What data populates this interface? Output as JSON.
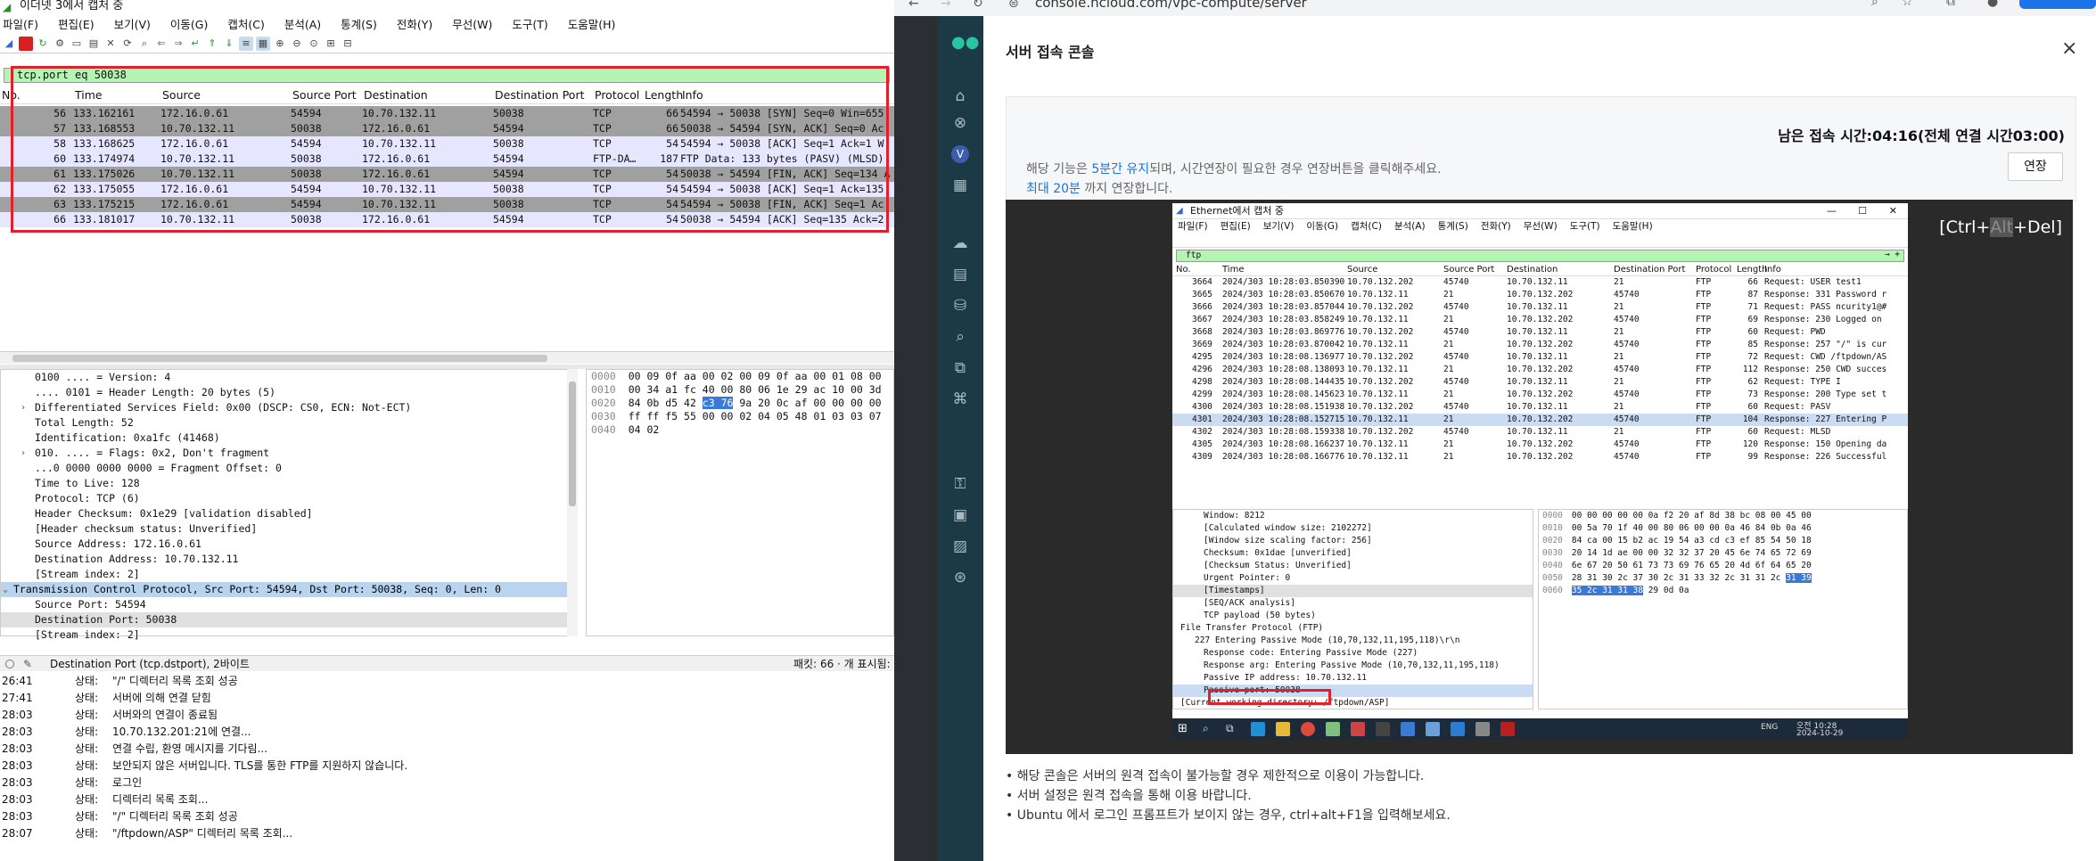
{
  "wireshark": {
    "title": "이더넷 3에서 캡처 중",
    "menu": [
      "파일(F)",
      "편집(E)",
      "보기(V)",
      "이동(G)",
      "캡처(C)",
      "분석(A)",
      "통계(S)",
      "전화(Y)",
      "무선(W)",
      "도구(T)",
      "도움말(H)"
    ],
    "filter": "tcp.port eq 50038",
    "columns": [
      "No.",
      "Time",
      "Source",
      "Source Port",
      "Destination",
      "Destination Port",
      "Protocol",
      "Length",
      "Info"
    ],
    "packets": [
      {
        "no": "56",
        "time": "133.162161",
        "src": "172.16.0.61",
        "sport": "54594",
        "dst": "10.70.132.11",
        "dport": "50038",
        "proto": "TCP",
        "len": "66",
        "info": "54594 → 50038 [SYN] Seq=0 Win=655",
        "bg": "#a0a0a0"
      },
      {
        "no": "57",
        "time": "133.168553",
        "src": "10.70.132.11",
        "sport": "50038",
        "dst": "172.16.0.61",
        "dport": "54594",
        "proto": "TCP",
        "len": "66",
        "info": "50038 → 54594 [SYN, ACK] Seq=0 Ac",
        "bg": "#a0a0a0"
      },
      {
        "no": "58",
        "time": "133.168625",
        "src": "172.16.0.61",
        "sport": "54594",
        "dst": "10.70.132.11",
        "dport": "50038",
        "proto": "TCP",
        "len": "54",
        "info": "54594 → 50038 [ACK] Seq=1 Ack=1 W",
        "bg": "#e7e6ff"
      },
      {
        "no": "60",
        "time": "133.174974",
        "src": "10.70.132.11",
        "sport": "50038",
        "dst": "172.16.0.61",
        "dport": "54594",
        "proto": "FTP-DA…",
        "len": "187",
        "info": "FTP Data: 133 bytes (PASV) (MLSD)",
        "bg": "#e7e6ff"
      },
      {
        "no": "61",
        "time": "133.175026",
        "src": "10.70.132.11",
        "sport": "50038",
        "dst": "172.16.0.61",
        "dport": "54594",
        "proto": "TCP",
        "len": "54",
        "info": "50038 → 54594 [FIN, ACK] Seq=134 A",
        "bg": "#a0a0a0"
      },
      {
        "no": "62",
        "time": "133.175055",
        "src": "172.16.0.61",
        "sport": "54594",
        "dst": "10.70.132.11",
        "dport": "50038",
        "proto": "TCP",
        "len": "54",
        "info": "54594 → 50038 [ACK] Seq=1 Ack=135",
        "bg": "#e7e6ff"
      },
      {
        "no": "63",
        "time": "133.175215",
        "src": "172.16.0.61",
        "sport": "54594",
        "dst": "10.70.132.11",
        "dport": "50038",
        "proto": "TCP",
        "len": "54",
        "info": "54594 → 50038 [FIN, ACK] Seq=1 Ac",
        "bg": "#a0a0a0"
      },
      {
        "no": "66",
        "time": "133.181017",
        "src": "10.70.132.11",
        "sport": "50038",
        "dst": "172.16.0.61",
        "dport": "54594",
        "proto": "TCP",
        "len": "54",
        "info": "50038 → 54594 [ACK] Seq=135 Ack=2",
        "bg": "#e7e6ff"
      }
    ],
    "details": [
      {
        "text": "0100 .... = Version: 4",
        "cls": ""
      },
      {
        "text": ".... 0101 = Header Length: 20 bytes (5)",
        "cls": ""
      },
      {
        "text": "Differentiated Services Field: 0x00 (DSCP: CS0, ECN: Not-ECT)",
        "cls": "",
        "arrow": "›"
      },
      {
        "text": "Total Length: 52",
        "cls": ""
      },
      {
        "text": "Identification: 0xa1fc (41468)",
        "cls": ""
      },
      {
        "text": "010. .... = Flags: 0x2, Don't fragment",
        "cls": "",
        "arrow": "›"
      },
      {
        "text": "...0 0000 0000 0000 = Fragment Offset: 0",
        "cls": ""
      },
      {
        "text": "Time to Live: 128",
        "cls": ""
      },
      {
        "text": "Protocol: TCP (6)",
        "cls": ""
      },
      {
        "text": "Header Checksum: 0x1e29 [validation disabled]",
        "cls": ""
      },
      {
        "text": "[Header checksum status: Unverified]",
        "cls": ""
      },
      {
        "text": "Source Address: 172.16.0.61",
        "cls": ""
      },
      {
        "text": "Destination Address: 10.70.132.11",
        "cls": ""
      },
      {
        "text": "[Stream index: 2]",
        "cls": ""
      },
      {
        "text": "Transmission Control Protocol, Src Port: 54594, Dst Port: 50038, Seq: 0, Len: 0",
        "cls": "l1 sel",
        "arrow": "⌄"
      },
      {
        "text": "Source Port: 54594",
        "cls": ""
      },
      {
        "text": "Destination Port: 50038",
        "cls": "hl"
      },
      {
        "text": "[Stream index: 2]",
        "cls": ""
      }
    ],
    "hex": [
      {
        "off": "0000",
        "a": "00 09 0f aa 00 02 00 09  0f aa 00 01 08 00",
        "sel": "",
        "b": ""
      },
      {
        "off": "0010",
        "a": "00 34 a1 fc 40 00 80 06  1e 29 ac 10 00 3d",
        "sel": "",
        "b": ""
      },
      {
        "off": "0020",
        "a": "84 0b d5 42 ",
        "sel": "c3 76",
        "b": " 9a 20  0c af 00 00 00 00"
      },
      {
        "off": "0030",
        "a": "ff ff f5 55 00 00 02 04  05 48 01 03 03 07",
        "sel": "",
        "b": ""
      },
      {
        "off": "0040",
        "a": "04 02",
        "sel": "",
        "b": ""
      }
    ],
    "status_field": "Destination Port (tcp.dstport), 2바이트",
    "status_right": "패킷: 66 · 개 표시됨:",
    "log": [
      {
        "t": "26:41",
        "s": "상태:",
        "m": "\"/\" 디렉터리 목록 조회 성공"
      },
      {
        "t": "27:41",
        "s": "상태:",
        "m": "서버에 의해 연결 닫힘"
      },
      {
        "t": "28:03",
        "s": "상태:",
        "m": "서버와의 연결이 종료됨"
      },
      {
        "t": "28:03",
        "s": "상태:",
        "m": "10.70.132.201:21에 연결..."
      },
      {
        "t": "28:03",
        "s": "상태:",
        "m": "연결 수립, 환영 메시지를 기다림..."
      },
      {
        "t": "28:03",
        "s": "상태:",
        "m": "보안되지 않은 서버입니다. TLS를 통한 FTP를 지원하지 않습니다."
      },
      {
        "t": "28:03",
        "s": "상태:",
        "m": "로그인"
      },
      {
        "t": "28:03",
        "s": "상태:",
        "m": "디렉터리 목록 조회..."
      },
      {
        "t": "28:03",
        "s": "상태:",
        "m": "\"/\" 디렉터리 목록 조회 성공"
      },
      {
        "t": "28:07",
        "s": "상태:",
        "m": "\"/ftpdown/ASP\" 디렉터리 목록 조회..."
      }
    ]
  },
  "browser": {
    "url": "console.ncloud.com/vpc-compute/server",
    "modal": {
      "title": "서버 접속 콘솔",
      "close": "×",
      "timer": "남은 접속 시간:04:16(전체 연결 시간03:00)",
      "extend": "연장",
      "info1_pre": "해당 기능은 ",
      "info1_link": "5분간 유지",
      "info1_post": "되며, 시간연장이 필요한 경우 연장버튼을 클릭해주세요.",
      "info2_link": "최대 20분",
      "info2_post": " 까지 연장합니다.",
      "ctrl_pre": "[Ctrl+",
      "ctrl_dim": "Alt",
      "ctrl_post": "+Del]",
      "notes": [
        "해당 콘솔은 서버의 원격 접속이 불가능할 경우 제한적으로 이용이 가능합니다.",
        "서버 설정은 원격 접속을 통해 이용 바랍니다.",
        "Ubuntu 에서 로그인 프롬프트가 보이지 않는 경우, ctrl+alt+F1을 입력해보세요."
      ]
    },
    "remote": {
      "title": "Ethernet에서 캡처 중",
      "menu": [
        "파일(F)",
        "편집(E)",
        "보기(V)",
        "이동(G)",
        "캡처(C)",
        "분석(A)",
        "통계(S)",
        "전화(Y)",
        "무선(W)",
        "도구(T)",
        "도움말(H)"
      ],
      "filter": "ftp",
      "columns": [
        "No.",
        "Time",
        "Source",
        "Source Port",
        "Destination",
        "Destination Port",
        "Protocol",
        "Length",
        "Info"
      ],
      "packets": [
        {
          "no": "3664",
          "time": "2024/303 10:28:03.850390",
          "src": "10.70.132.202",
          "sport": "45740",
          "dst": "10.70.132.11",
          "dport": "21",
          "proto": "FTP",
          "len": "66",
          "info": "Request: USER test1",
          "sel": false
        },
        {
          "no": "3665",
          "time": "2024/303 10:28:03.850670",
          "src": "10.70.132.11",
          "sport": "21",
          "dst": "10.70.132.202",
          "dport": "45740",
          "proto": "FTP",
          "len": "87",
          "info": "Response: 331 Password r",
          "sel": false
        },
        {
          "no": "3666",
          "time": "2024/303 10:28:03.857044",
          "src": "10.70.132.202",
          "sport": "45740",
          "dst": "10.70.132.11",
          "dport": "21",
          "proto": "FTP",
          "len": "71",
          "info": "Request: PASS ncurity1@#",
          "sel": false
        },
        {
          "no": "3667",
          "time": "2024/303 10:28:03.858249",
          "src": "10.70.132.11",
          "sport": "21",
          "dst": "10.70.132.202",
          "dport": "45740",
          "proto": "FTP",
          "len": "69",
          "info": "Response: 230 Logged on",
          "sel": false
        },
        {
          "no": "3668",
          "time": "2024/303 10:28:03.869776",
          "src": "10.70.132.202",
          "sport": "45740",
          "dst": "10.70.132.11",
          "dport": "21",
          "proto": "FTP",
          "len": "60",
          "info": "Request: PWD",
          "sel": false
        },
        {
          "no": "3669",
          "time": "2024/303 10:28:03.870042",
          "src": "10.70.132.11",
          "sport": "21",
          "dst": "10.70.132.202",
          "dport": "45740",
          "proto": "FTP",
          "len": "85",
          "info": "Response: 257 \"/\" is cur",
          "sel": false
        },
        {
          "no": "4295",
          "time": "2024/303 10:28:08.136977",
          "src": "10.70.132.202",
          "sport": "45740",
          "dst": "10.70.132.11",
          "dport": "21",
          "proto": "FTP",
          "len": "72",
          "info": "Request: CWD /ftpdown/AS",
          "sel": false
        },
        {
          "no": "4296",
          "time": "2024/303 10:28:08.138093",
          "src": "10.70.132.11",
          "sport": "21",
          "dst": "10.70.132.202",
          "dport": "45740",
          "proto": "FTP",
          "len": "112",
          "info": "Response: 250 CWD succes",
          "sel": false
        },
        {
          "no": "4298",
          "time": "2024/303 10:28:08.144435",
          "src": "10.70.132.202",
          "sport": "45740",
          "dst": "10.70.132.11",
          "dport": "21",
          "proto": "FTP",
          "len": "62",
          "info": "Request: TYPE I",
          "sel": false
        },
        {
          "no": "4299",
          "time": "2024/303 10:28:08.145623",
          "src": "10.70.132.11",
          "sport": "21",
          "dst": "10.70.132.202",
          "dport": "45740",
          "proto": "FTP",
          "len": "73",
          "info": "Response: 200 Type set t",
          "sel": false
        },
        {
          "no": "4300",
          "time": "2024/303 10:28:08.151938",
          "src": "10.70.132.202",
          "sport": "45740",
          "dst": "10.70.132.11",
          "dport": "21",
          "proto": "FTP",
          "len": "60",
          "info": "Request: PASV",
          "sel": false
        },
        {
          "no": "4301",
          "time": "2024/303 10:28:08.152715",
          "src": "10.70.132.11",
          "sport": "21",
          "dst": "10.70.132.202",
          "dport": "45740",
          "proto": "FTP",
          "len": "104",
          "info": "Response: 227 Entering P",
          "sel": true
        },
        {
          "no": "4302",
          "time": "2024/303 10:28:08.159338",
          "src": "10.70.132.202",
          "sport": "45740",
          "dst": "10.70.132.11",
          "dport": "21",
          "proto": "FTP",
          "len": "60",
          "info": "Request: MLSD",
          "sel": false
        },
        {
          "no": "4305",
          "time": "2024/303 10:28:08.166237",
          "src": "10.70.132.11",
          "sport": "21",
          "dst": "10.70.132.202",
          "dport": "45740",
          "proto": "FTP",
          "len": "120",
          "info": "Response: 150 Opening da",
          "sel": false
        },
        {
          "no": "4309",
          "time": "2024/303 10:28:08.166776",
          "src": "10.70.132.11",
          "sport": "21",
          "dst": "10.70.132.202",
          "dport": "45740",
          "proto": "FTP",
          "len": "99",
          "info": "Response: 226 Successful",
          "sel": false
        }
      ],
      "details": [
        {
          "text": "Window: 8212",
          "cls": "l3"
        },
        {
          "text": "[Calculated window size: 2102272]",
          "cls": "l3"
        },
        {
          "text": "[Window size scaling factor: 256]",
          "cls": "l3"
        },
        {
          "text": "Checksum: 0x1dae [unverified]",
          "cls": "l3"
        },
        {
          "text": "[Checksum Status: Unverified]",
          "cls": "l3"
        },
        {
          "text": "Urgent Pointer: 0",
          "cls": "l3"
        },
        {
          "text": "[Timestamps]",
          "cls": "l3 hl"
        },
        {
          "text": "[SEQ/ACK analysis]",
          "cls": "l3"
        },
        {
          "text": "TCP payload (50 bytes)",
          "cls": "l3"
        },
        {
          "text": "File Transfer Protocol (FTP)",
          "cls": "l1"
        },
        {
          "text": "227 Entering Passive Mode (10,70,132,11,195,118)\\r\\n",
          "cls": "l2"
        },
        {
          "text": "Response code: Entering Passive Mode (227)",
          "cls": "l3"
        },
        {
          "text": "Response arg: Entering Passive Mode (10,70,132,11,195,118)",
          "cls": "l3"
        },
        {
          "text": "Passive IP address: 10.70.132.11",
          "cls": "l3"
        },
        {
          "text": "Passive port: 50038",
          "cls": "l3 sel"
        },
        {
          "text": "[Current working directory: /ftpdown/ASP]",
          "cls": "l1"
        }
      ],
      "hex": [
        {
          "off": "0000",
          "a": "00 00 00 00 00 0a f2 20  af 8d 38 bc 08 00 45 00",
          "b": "",
          "sel": ""
        },
        {
          "off": "0010",
          "a": "00 5a 70 1f 40 00 80 06  00 00 0a 46 84 0b 0a 46",
          "b": "",
          "sel": ""
        },
        {
          "off": "0020",
          "a": "84 ca 00 15 b2 ac 19 54  a3 cd c3 ef 85 54 50 18",
          "b": "",
          "sel": ""
        },
        {
          "off": "0030",
          "a": "20 14 1d ae 00 00 32 32  37 20 45 6e 74 65 72 69",
          "b": "",
          "sel": ""
        },
        {
          "off": "0040",
          "a": "6e 67 20 50 61 73 73 69  76 65 20 4d 6f 64 65 20",
          "b": "",
          "sel": ""
        },
        {
          "off": "0050",
          "a": "28 31 30 2c 37 30 2c 31  33 32 2c 31 31 2c ",
          "b": "",
          "sel": "31 39"
        },
        {
          "off": "0060",
          "a": "",
          "b": " 29 0d 0a",
          "sel": "35 2c 31 31 38"
        }
      ],
      "clock": "오전 10:28",
      "date": "2024-10-29",
      "lang": "ENG"
    }
  }
}
